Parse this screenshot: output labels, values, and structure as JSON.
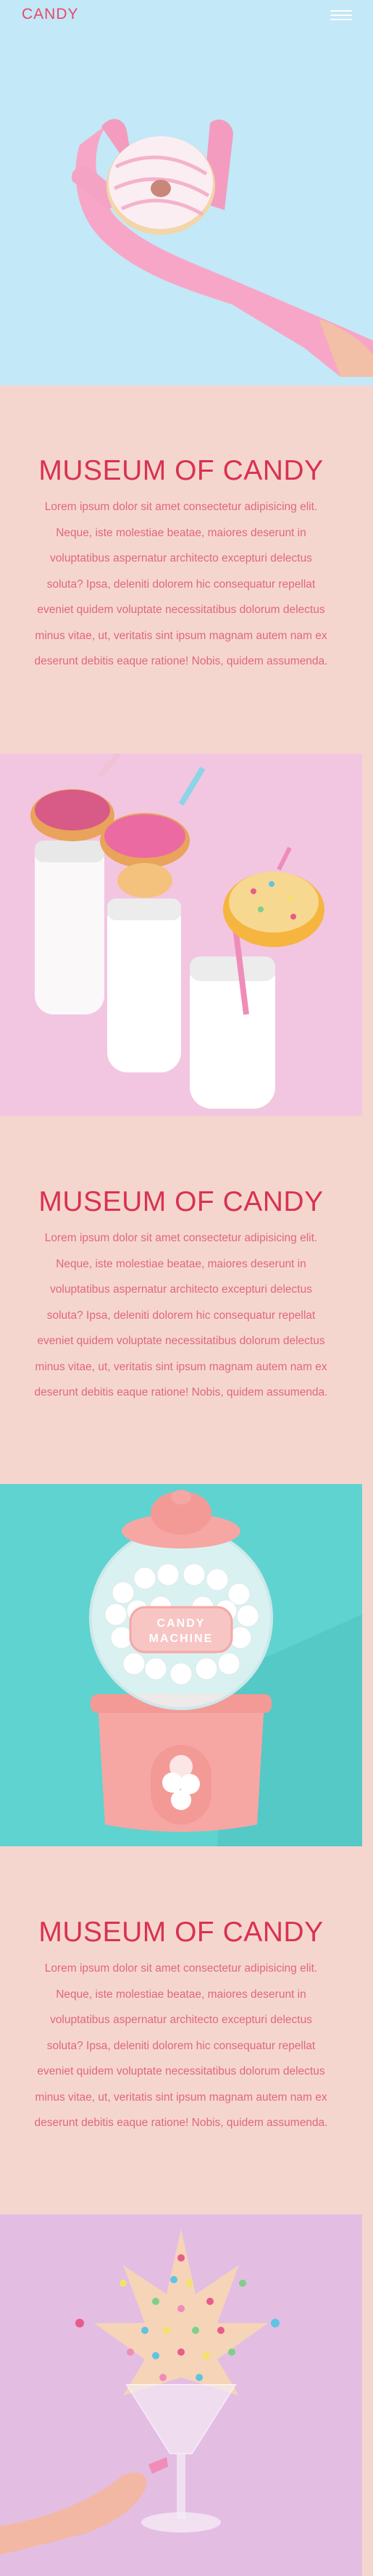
{
  "header": {
    "brand": "CANDY",
    "menu_icon": "hamburger-menu-icon"
  },
  "sections": [
    {
      "title": "MUSEUM OF CANDY",
      "body": "Lorem ipsum dolor sit amet consectetur adipisicing elit. Neque, iste molestiae beatae, maiores deserunt in voluptatibus aspernatur architecto excepturi delectus soluta? Ipsa, deleniti dolorem hic consequatur repellat eveniet quidem voluptate necessitatibus dolorum delectus minus vitae, ut, veritatis sint ipsum magnam autem nam ex deserunt debitis eaque ratione! Nobis, quidem assumenda."
    },
    {
      "title": "MUSEUM OF CANDY",
      "body": "Lorem ipsum dolor sit amet consectetur adipisicing elit. Neque, iste molestiae beatae, maiores deserunt in voluptatibus aspernatur architecto excepturi delectus soluta? Ipsa, deleniti dolorem hic consequatur repellat eveniet quidem voluptate necessitatibus dolorum delectus minus vitae, ut, veritatis sint ipsum magnam autem nam ex deserunt debitis eaque ratione! Nobis, quidem assumenda."
    },
    {
      "title": "MUSEUM OF CANDY",
      "body": "Lorem ipsum dolor sit amet consectetur adipisicing elit. Neque, iste molestiae beatae, maiores deserunt in voluptatibus aspernatur architecto excepturi delectus soluta? Ipsa, deleniti dolorem hic consequatur repellat eveniet quidem voluptate necessitatibus dolorum delectus minus vitae, ut, veritatis sint ipsum magnam autem nam ex deserunt debitis eaque ratione! Nobis, quidem assumenda."
    }
  ],
  "images": {
    "gumball_label": "CANDY MACHINE"
  },
  "colors": {
    "page_bg": "#f5d6cf",
    "brand": "#e8486a",
    "title": "#d9324f",
    "body_text": "#e0687a",
    "hero_bg": "#c3e8f7",
    "photo1_bg": "#f2c6e0",
    "photo2_bg": "#5fd3cf",
    "photo3_bg": "#e4bde3"
  }
}
